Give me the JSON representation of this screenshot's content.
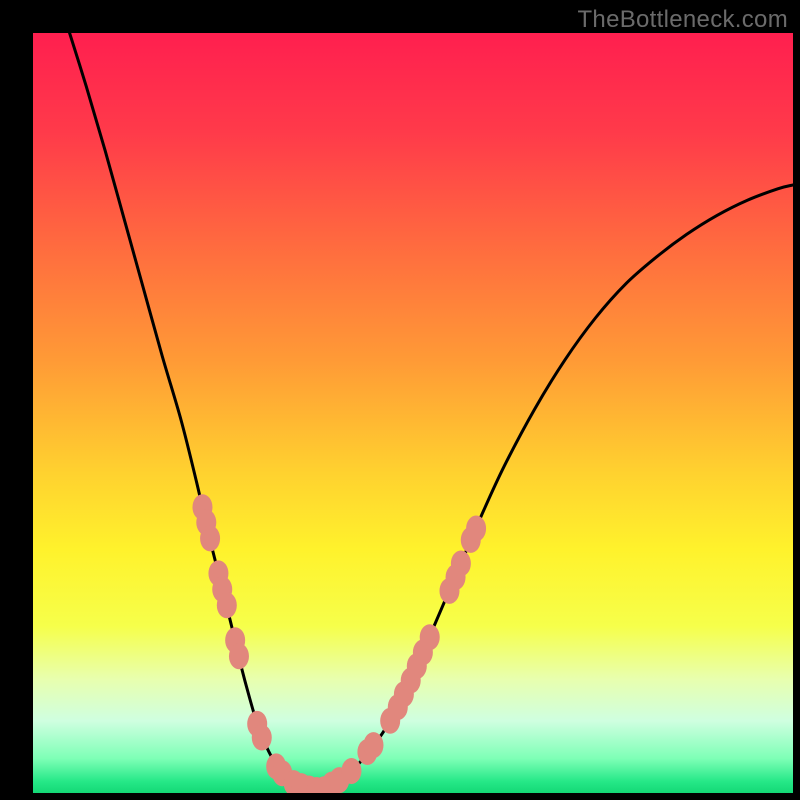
{
  "watermark": {
    "text": "TheBottleneck.com"
  },
  "chart_data": {
    "type": "line",
    "title": "",
    "xlabel": "",
    "ylabel": "",
    "xlim": [
      0,
      1
    ],
    "ylim": [
      0,
      1
    ],
    "legend": false,
    "gradient_stops": [
      {
        "offset": 0.0,
        "color": "#ff1f4f"
      },
      {
        "offset": 0.13,
        "color": "#ff3a4a"
      },
      {
        "offset": 0.28,
        "color": "#ff6b3f"
      },
      {
        "offset": 0.43,
        "color": "#ff9a36"
      },
      {
        "offset": 0.58,
        "color": "#ffd22f"
      },
      {
        "offset": 0.68,
        "color": "#fff22c"
      },
      {
        "offset": 0.78,
        "color": "#f6ff4a"
      },
      {
        "offset": 0.85,
        "color": "#e8ffae"
      },
      {
        "offset": 0.905,
        "color": "#cfffe0"
      },
      {
        "offset": 0.955,
        "color": "#7dffb6"
      },
      {
        "offset": 0.985,
        "color": "#25e887"
      },
      {
        "offset": 1.0,
        "color": "#14d876"
      }
    ],
    "series": [
      {
        "name": "bottleneck-curve",
        "stroke": "#000000",
        "stroke_width": 3,
        "x": [
          0.045,
          0.07,
          0.095,
          0.12,
          0.145,
          0.17,
          0.195,
          0.215,
          0.23,
          0.245,
          0.26,
          0.273,
          0.285,
          0.297,
          0.31,
          0.325,
          0.345,
          0.37,
          0.395,
          0.42,
          0.445,
          0.47,
          0.5,
          0.53,
          0.56,
          0.59,
          0.62,
          0.66,
          0.7,
          0.74,
          0.78,
          0.82,
          0.86,
          0.9,
          0.94,
          0.98,
          1.0
        ],
        "y": [
          1.01,
          0.93,
          0.845,
          0.755,
          0.665,
          0.575,
          0.49,
          0.41,
          0.345,
          0.285,
          0.225,
          0.17,
          0.125,
          0.085,
          0.055,
          0.03,
          0.012,
          0.004,
          0.012,
          0.03,
          0.058,
          0.095,
          0.155,
          0.225,
          0.295,
          0.365,
          0.43,
          0.505,
          0.57,
          0.625,
          0.67,
          0.705,
          0.735,
          0.76,
          0.78,
          0.795,
          0.8
        ]
      }
    ],
    "marker_clusters": [
      {
        "name": "left-cluster",
        "color": "#e1877d",
        "points": [
          {
            "x": 0.223,
            "y": 0.376
          },
          {
            "x": 0.228,
            "y": 0.356
          },
          {
            "x": 0.233,
            "y": 0.335
          },
          {
            "x": 0.244,
            "y": 0.289
          },
          {
            "x": 0.249,
            "y": 0.268
          },
          {
            "x": 0.255,
            "y": 0.247
          },
          {
            "x": 0.266,
            "y": 0.201
          },
          {
            "x": 0.271,
            "y": 0.18
          },
          {
            "x": 0.295,
            "y": 0.091
          },
          {
            "x": 0.301,
            "y": 0.073
          },
          {
            "x": 0.32,
            "y": 0.035
          },
          {
            "x": 0.328,
            "y": 0.026
          }
        ]
      },
      {
        "name": "bottom-cluster",
        "color": "#e1877d",
        "points": [
          {
            "x": 0.343,
            "y": 0.013
          },
          {
            "x": 0.353,
            "y": 0.009
          },
          {
            "x": 0.363,
            "y": 0.006
          },
          {
            "x": 0.373,
            "y": 0.004
          },
          {
            "x": 0.383,
            "y": 0.005
          },
          {
            "x": 0.393,
            "y": 0.011
          },
          {
            "x": 0.403,
            "y": 0.017
          }
        ]
      },
      {
        "name": "right-cluster",
        "color": "#e1877d",
        "points": [
          {
            "x": 0.419,
            "y": 0.029
          },
          {
            "x": 0.44,
            "y": 0.054
          },
          {
            "x": 0.448,
            "y": 0.063
          },
          {
            "x": 0.47,
            "y": 0.095
          },
          {
            "x": 0.48,
            "y": 0.113
          },
          {
            "x": 0.488,
            "y": 0.13
          },
          {
            "x": 0.497,
            "y": 0.148
          },
          {
            "x": 0.505,
            "y": 0.167
          },
          {
            "x": 0.513,
            "y": 0.185
          },
          {
            "x": 0.522,
            "y": 0.205
          },
          {
            "x": 0.548,
            "y": 0.266
          },
          {
            "x": 0.556,
            "y": 0.284
          },
          {
            "x": 0.563,
            "y": 0.302
          },
          {
            "x": 0.576,
            "y": 0.333
          },
          {
            "x": 0.583,
            "y": 0.348
          }
        ]
      }
    ]
  }
}
